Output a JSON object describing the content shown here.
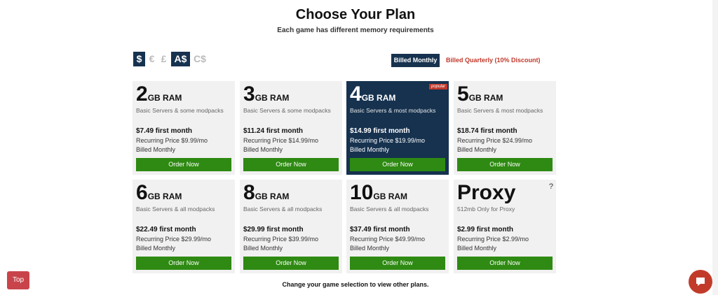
{
  "header": {
    "title": "Choose Your Plan",
    "subtitle": "Each game has different memory requirements"
  },
  "currencies": [
    {
      "symbol": "$",
      "active": true
    },
    {
      "symbol": "€",
      "active": false
    },
    {
      "symbol": "£",
      "active": false
    },
    {
      "symbol": "A$",
      "active": true
    },
    {
      "symbol": "C$",
      "active": false
    }
  ],
  "billing": {
    "monthly_label": "Billed Monthly",
    "quarterly_label": "Billed Quarterly (10% Discount)"
  },
  "plans": [
    {
      "size": "2",
      "unit": "GB RAM",
      "desc": "Basic Servers & some modpacks",
      "first": "$7.49 first month",
      "recurring": "Recurring Price $9.99/mo",
      "billed": "Billed Monthly",
      "order": "Order Now"
    },
    {
      "size": "3",
      "unit": "GB RAM",
      "desc": "Basic Servers & some modpacks",
      "first": "$11.24 first month",
      "recurring": "Recurring Price $14.99/mo",
      "billed": "Billed Monthly",
      "order": "Order Now"
    },
    {
      "size": "4",
      "unit": "GB RAM",
      "desc": "Basic Servers & most modpacks",
      "first": "$14.99 first month",
      "recurring": "Recurring Price $19.99/mo",
      "billed": "Billed Monthly",
      "order": "Order Now",
      "badge": "popular"
    },
    {
      "size": "5",
      "unit": "GB RAM",
      "desc": "Basic Servers & most modpacks",
      "first": "$18.74 first month",
      "recurring": "Recurring Price $24.99/mo",
      "billed": "Billed Monthly",
      "order": "Order Now"
    },
    {
      "size": "6",
      "unit": "GB RAM",
      "desc": "Basic Servers & all modpacks",
      "first": "$22.49 first month",
      "recurring": "Recurring Price $29.99/mo",
      "billed": "Billed Monthly",
      "order": "Order Now"
    },
    {
      "size": "8",
      "unit": "GB RAM",
      "desc": "Basic Servers & all modpacks",
      "first": "$29.99 first month",
      "recurring": "Recurring Price $39.99/mo",
      "billed": "Billed Monthly",
      "order": "Order Now"
    },
    {
      "size": "10",
      "unit": "GB RAM",
      "desc": "Basic Servers & all modpacks",
      "first": "$37.49 first month",
      "recurring": "Recurring Price $49.99/mo",
      "billed": "Billed Monthly",
      "order": "Order Now"
    },
    {
      "size": "Proxy",
      "unit": "",
      "desc": "512mb Only for Proxy",
      "first": "$2.99 first month",
      "recurring": "Recurring Price $2.99/mo",
      "billed": "Billed Monthly",
      "order": "Order Now",
      "help": "?"
    }
  ],
  "footer": {
    "note": "Change your game selection to view other plans.",
    "top_label": "Top"
  },
  "colors": {
    "navy": "#16324f",
    "green": "#2e8a12",
    "red": "#c0392b",
    "card_bg": "#f1f1f1"
  }
}
